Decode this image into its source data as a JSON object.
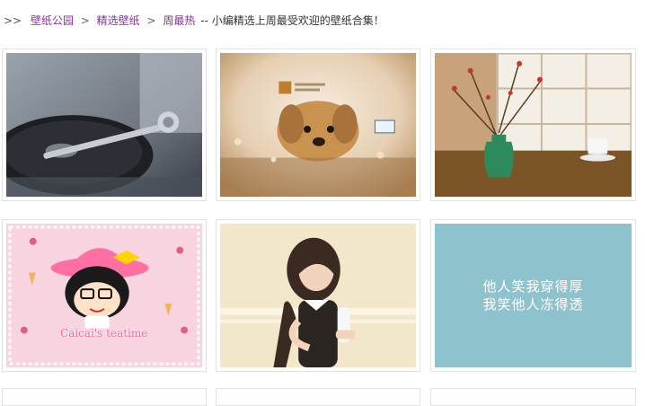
{
  "breadcrumb": {
    "lead": ">>",
    "items": [
      "壁纸公园",
      "精选壁纸",
      "周最热"
    ],
    "separator": ">",
    "note": "-- 小编精选上周最受欢迎的壁纸合集！"
  },
  "wallpapers": [
    {
      "subject": "turntable record player",
      "colors": {
        "main": "#6f7680",
        "dark": "#2c2f35"
      }
    },
    {
      "subject": "golden retriever in flowers",
      "colors": {
        "main": "#c9a06a",
        "light": "#f2e4cf"
      }
    },
    {
      "subject": "vase with branches by window",
      "colors": {
        "main": "#8b6436",
        "accent": "#2e8a5c"
      }
    },
    {
      "subject": "cartoon girl with pink hat",
      "caption": "Caicai's teatime",
      "colors": {
        "main": "#f7d4e0",
        "accent": "#ff6fa4"
      }
    },
    {
      "subject": "girl in black dress",
      "colors": {
        "main": "#f3e7c9",
        "dark": "#2b2521"
      }
    },
    {
      "subject": "quote card",
      "text_line1": "他人笑我穿得厚",
      "text_line2": "我笑他人冻得透",
      "colors": {
        "main": "#8ec3cd"
      }
    }
  ]
}
